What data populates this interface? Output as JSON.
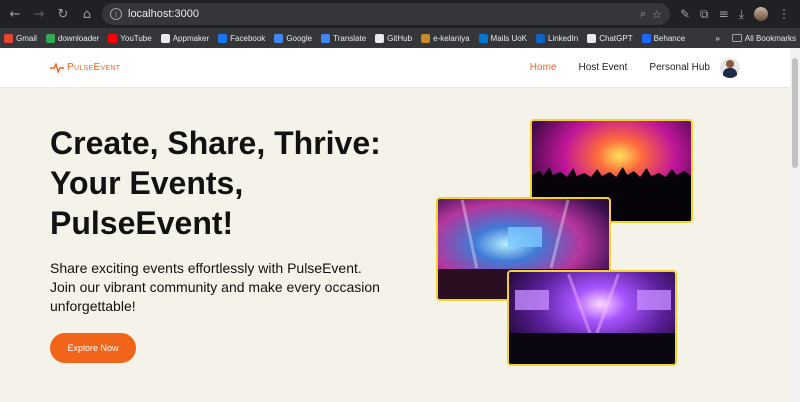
{
  "browser": {
    "url": "localhost:3000",
    "bookmarks": [
      {
        "label": "Gmail",
        "color": "#ea4335"
      },
      {
        "label": "downloader",
        "color": "#34a853"
      },
      {
        "label": "YouTube",
        "color": "#ff0000"
      },
      {
        "label": "Appmaker",
        "color": "#e8eaed"
      },
      {
        "label": "Facebook",
        "color": "#1877f2"
      },
      {
        "label": "Google",
        "color": "#4285f4"
      },
      {
        "label": "Translate",
        "color": "#4285f4"
      },
      {
        "label": "GitHub",
        "color": "#e8eaed"
      },
      {
        "label": "e-kelaniya",
        "color": "#c58b2b"
      },
      {
        "label": "Mails UoK",
        "color": "#0078d4"
      },
      {
        "label": "LinkedIn",
        "color": "#0a66c2"
      },
      {
        "label": "ChatGPT",
        "color": "#e8eaed"
      },
      {
        "label": "Behance",
        "color": "#1769ff"
      }
    ],
    "all_bookmarks_label": "All Bookmarks"
  },
  "site": {
    "logo_text": "PulseEvent",
    "nav": {
      "home": "Home",
      "host_event": "Host Event",
      "personal_hub": "Personal Hub"
    },
    "hero": {
      "title": "Create, Share, Thrive: Your Events, PulseEvent!",
      "subtitle": "Share exciting events effortlessly with PulseEvent. Join our vibrant community and make every occasion unforgettable!",
      "cta_label": "Explore Now"
    }
  },
  "colors": {
    "accent": "#f26419",
    "page_bg": "#f5f3e9",
    "photo_border": "#f2d22e"
  }
}
